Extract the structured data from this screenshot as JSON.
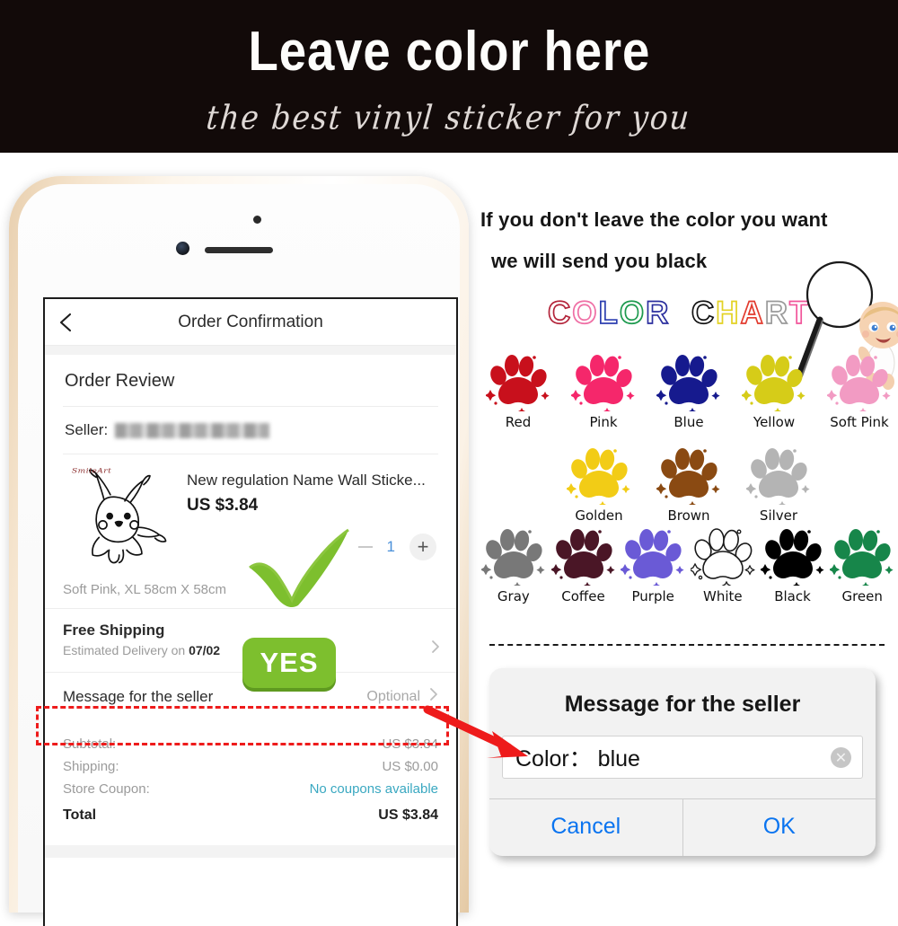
{
  "banner": {
    "title": "Leave color here",
    "subtitle": "the best vinyl sticker for you"
  },
  "phone": {
    "nav": {
      "back_icon": "chevron-left-icon",
      "title": "Order Confirmation"
    },
    "section_title": "Order Review",
    "seller": {
      "label": "Seller:",
      "value": ""
    },
    "product": {
      "watermark": "SmileArt",
      "title": "New regulation Name Wall Sticke...",
      "price": "US $3.84",
      "variant": "Soft Pink, XL 58cm X 58cm",
      "quantity": "1",
      "minus_label": "−",
      "plus_label": "+"
    },
    "shipping": {
      "title": "Free Shipping",
      "estimate_prefix": "Estimated Delivery on ",
      "estimate_date": "07/02"
    },
    "message_row": {
      "label": "Message for the seller",
      "value": "Optional"
    },
    "totals": [
      {
        "label": "Subtotal:",
        "value": "US $3.84",
        "style": "normal"
      },
      {
        "label": "Shipping:",
        "value": "US $0.00",
        "style": "normal"
      },
      {
        "label": "Store Coupon:",
        "value": "No coupons available",
        "style": "coupon"
      },
      {
        "label": "Total",
        "value": "US $3.84",
        "style": "total"
      }
    ]
  },
  "overlays": {
    "check_mark": "green-check-icon",
    "yes_badge": "YES"
  },
  "right": {
    "lead_line1": "If you don't leave the color you want",
    "lead_line2": "we will send you black",
    "color_chart_word": "COLOR CHART",
    "color_chart_letters": [
      {
        "ch": "C",
        "color": "#b3243a"
      },
      {
        "ch": "O",
        "color": "#ef6fa5"
      },
      {
        "ch": "L",
        "color": "#2c3fb0"
      },
      {
        "ch": "O",
        "color": "#1d9a4e"
      },
      {
        "ch": "R",
        "color": "#2b2f9e"
      },
      {
        "ch": " ",
        "color": "#000000"
      },
      {
        "ch": "C",
        "color": "#111111"
      },
      {
        "ch": "H",
        "color": "#e3d225"
      },
      {
        "ch": "A",
        "color": "#e23b2e"
      },
      {
        "ch": "R",
        "color": "#9a9a9a"
      },
      {
        "ch": "T",
        "color": "#f1559a"
      }
    ],
    "swatch_rows": [
      [
        {
          "label": "Red",
          "color": "#c8101c",
          "outline": false
        },
        {
          "label": "Pink",
          "color": "#f5276b",
          "outline": false
        },
        {
          "label": "Blue",
          "color": "#161a8e",
          "outline": false
        },
        {
          "label": "Yellow",
          "color": "#d6cc18",
          "outline": false
        },
        {
          "label": "Soft Pink",
          "color": "#f29bc3",
          "outline": false
        }
      ],
      [
        {
          "label": "Golden",
          "color": "#f2cc16",
          "outline": false
        },
        {
          "label": "Brown",
          "color": "#8a4a12",
          "outline": false
        },
        {
          "label": "Silver",
          "color": "#b4b4b4",
          "outline": false
        }
      ],
      [
        {
          "label": "Gray",
          "color": "#787878",
          "outline": false
        },
        {
          "label": "Coffee",
          "color": "#4a1626",
          "outline": false
        },
        {
          "label": "Purple",
          "color": "#6a5ad6",
          "outline": false
        },
        {
          "label": "White",
          "color": "#ffffff",
          "outline": true
        },
        {
          "label": "Black",
          "color": "#000000",
          "outline": false
        },
        {
          "label": "Green",
          "color": "#17864a",
          "outline": false
        }
      ]
    ]
  },
  "dialog": {
    "title": "Message for the seller",
    "field_value": "Color： blue",
    "clear_icon": "clear-circle-icon",
    "cancel_label": "Cancel",
    "ok_label": "OK"
  },
  "colors": {
    "accent_blue": "#0a74f0",
    "highlight_red": "#ee1b1b",
    "check_green": "#7ac143",
    "coupon_teal": "#3aa8c1"
  }
}
